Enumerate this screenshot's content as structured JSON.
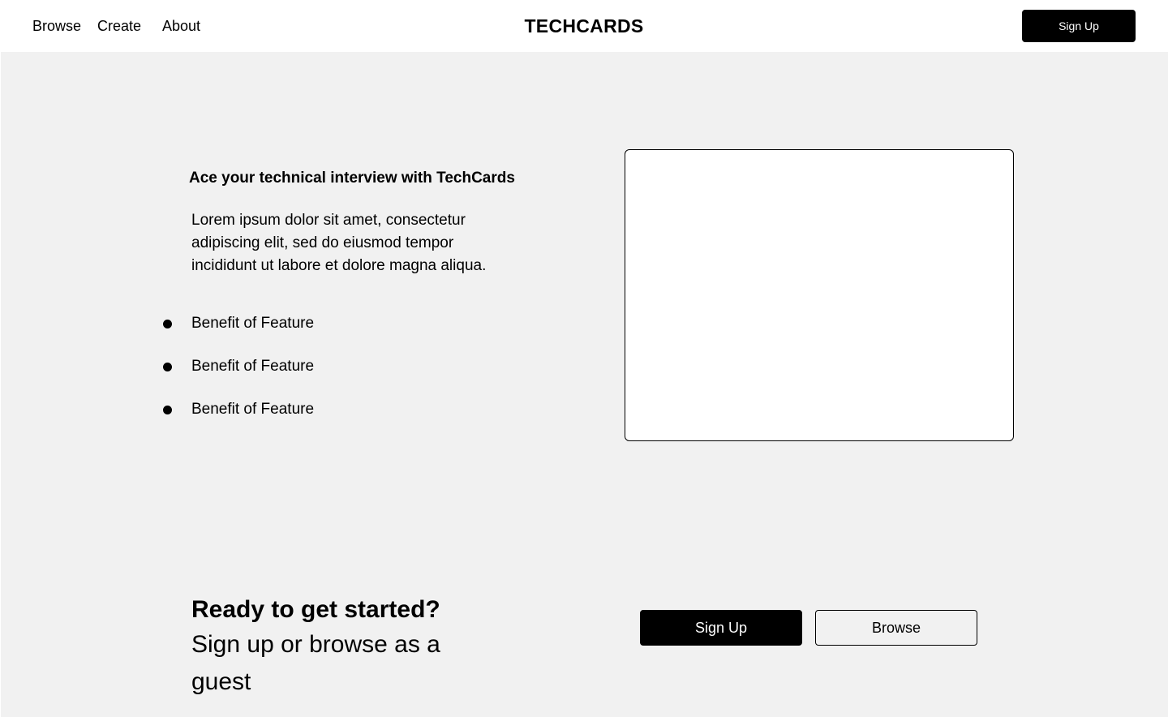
{
  "nav": {
    "links": [
      {
        "label": "Browse"
      },
      {
        "label": "Create"
      },
      {
        "label": "About"
      }
    ],
    "brand": "TECHCARDS",
    "signup_label": "Sign Up"
  },
  "hero": {
    "heading": "Ace your technical interview with TechCards",
    "body": "Lorem ipsum dolor sit amet, consectetur adipiscing elit, sed do eiusmod tempor incididunt ut labore et dolore magna aliqua.",
    "benefits": [
      "Benefit of Feature",
      "Benefit of Feature",
      "Benefit of Feature"
    ]
  },
  "cta": {
    "heading": "Ready to get started?",
    "subheading": "Sign up or browse as a guest",
    "signup_label": "Sign Up",
    "browse_label": "Browse"
  },
  "colors": {
    "page_background": "#f1f1f1",
    "header_background": "#ffffff",
    "primary_button": "#000000",
    "primary_button_text": "#ffffff"
  }
}
